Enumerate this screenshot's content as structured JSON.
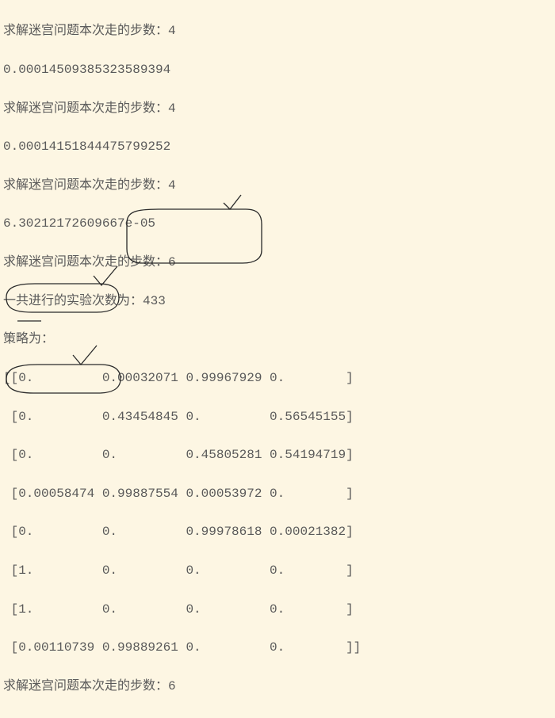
{
  "output": {
    "line1": "求解迷宫问题本次走的步数：4",
    "line2": "0.00014509385323589394",
    "line3": "求解迷宫问题本次走的步数：4",
    "line4": "0.00014151844475799252",
    "line5": "求解迷宫问题本次走的步数：4",
    "line6": "6.30212172609667e-05",
    "line7": "求解迷宫问题本次走的步数：6",
    "line8": "一共进行的实验次数为：433",
    "line9": "策略为：",
    "line10": "[[0.         0.00032071 0.99967929 0.        ]",
    "line11": " [0.         0.43454845 0.         0.56545155]",
    "line12": " [0.         0.         0.45805281 0.54194719]",
    "line13": " [0.00058474 0.99887554 0.00053972 0.        ]",
    "line14": " [0.         0.         0.99978618 0.00021382]",
    "line15": " [1.         0.         0.         0.        ]",
    "line16": " [1.         0.         0.         0.        ]",
    "line17": " [0.00110739 0.99889261 0.         0.        ]]",
    "line18": "求解迷宫问题本次走的步数：6"
  }
}
